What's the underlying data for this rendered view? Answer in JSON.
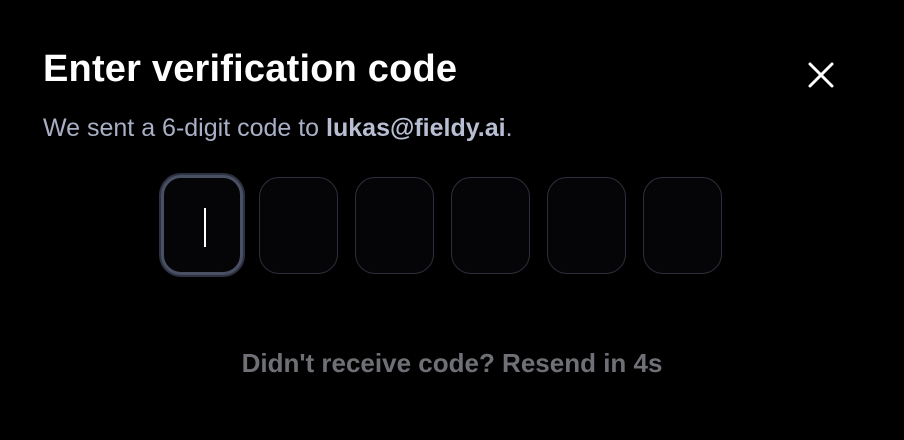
{
  "dialog": {
    "title": "Enter verification code",
    "subtitle_prefix": "We sent a 6-digit code to ",
    "email": "lukas@fieldy.ai",
    "subtitle_suffix": ".",
    "close_icon": "close-icon",
    "code_digits": [
      "",
      "",
      "",
      "",
      "",
      ""
    ],
    "resend_text": "Didn't receive code? Resend in 4s"
  },
  "colors": {
    "background": "#000000",
    "title": "#ffffff",
    "subtitle": "#a9afc4",
    "box_border": "#2c2f3c",
    "active_box_border": "#4a5063",
    "resend": "#6e7076"
  }
}
